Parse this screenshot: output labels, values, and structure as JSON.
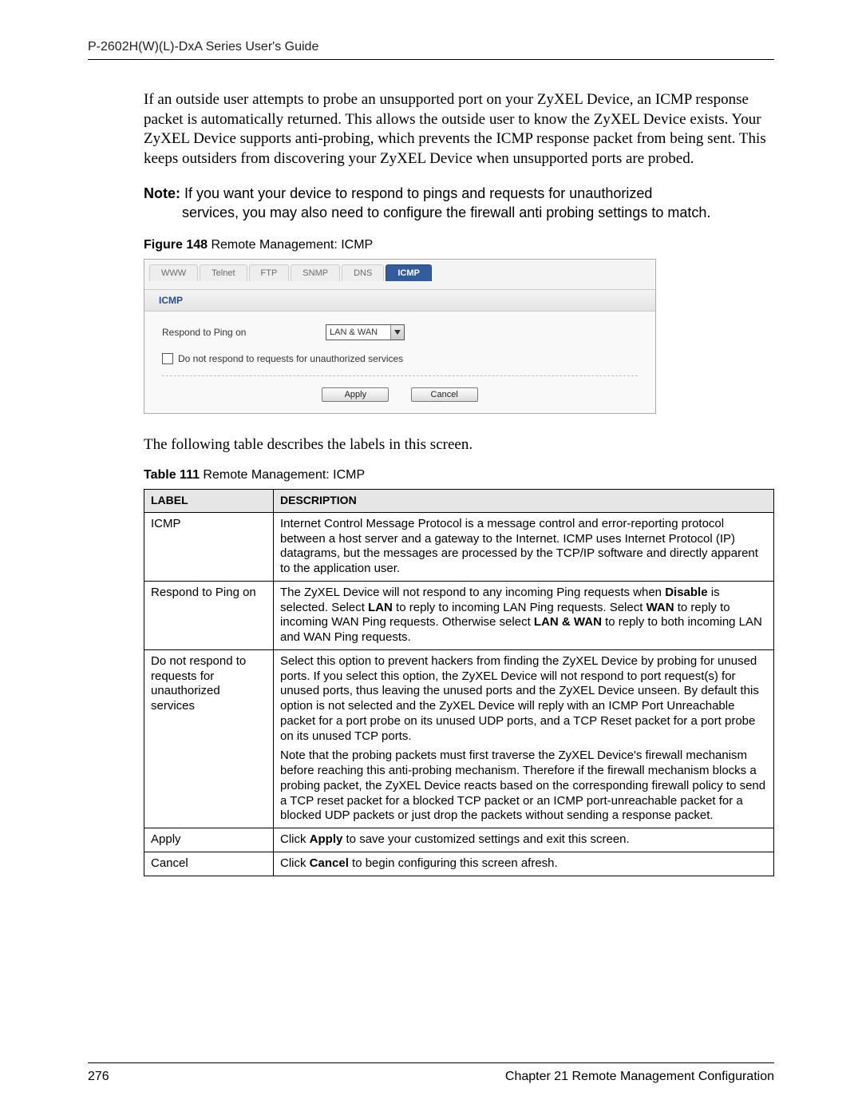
{
  "header": "P-2602H(W)(L)-DxA Series User's Guide",
  "intro": "If an outside user attempts to probe an unsupported port on your ZyXEL Device, an ICMP response packet is automatically returned. This allows the outside user to know the ZyXEL Device exists. Your ZyXEL Device supports anti-probing, which prevents the ICMP response packet from being sent. This keeps outsiders from discovering your ZyXEL Device when unsupported ports are probed.",
  "note_label": "Note:",
  "note_body": "If you want your device to respond to pings and requests for unauthorized services, you may also need to configure the firewall anti probing settings to match.",
  "figure": {
    "prefix": "Figure 148",
    "title": "   Remote Management: ICMP"
  },
  "ui": {
    "tabs": [
      "WWW",
      "Telnet",
      "FTP",
      "SNMP",
      "DNS",
      "ICMP"
    ],
    "active_tab": "ICMP",
    "section": "ICMP",
    "respond_label": "Respond to Ping on",
    "respond_value": "LAN & WAN",
    "checkbox_label": "Do not respond to requests for unauthorized services",
    "apply": "Apply",
    "cancel": "Cancel"
  },
  "after_fig": "The following table describes the labels in this screen.",
  "table_caption": {
    "prefix": "Table 111",
    "title": "   Remote Management: ICMP"
  },
  "table": {
    "h1": "Label",
    "h2": "Description",
    "rows": [
      {
        "label": "ICMP",
        "desc_html": "Internet Control Message Protocol is a message control and error-reporting protocol between a host server and a gateway to the Internet. ICMP uses Internet Protocol (IP) datagrams, but the messages are processed by the TCP/IP software and directly apparent to the application user."
      },
      {
        "label": "Respond to Ping on",
        "desc_html": "The ZyXEL Device will not respond to any incoming Ping requests when <b>Disable</b> is selected. Select <b>LAN</b> to reply to incoming LAN Ping requests. Select <b>WAN</b> to reply to incoming WAN Ping requests. Otherwise select <b>LAN & WAN</b> to reply to both incoming LAN and WAN Ping requests."
      },
      {
        "label": "Do not respond to requests for unauthorized services",
        "desc_html": "Select this option to prevent hackers from finding the ZyXEL Device by probing for unused ports. If you select this option, the ZyXEL Device will not respond to port request(s) for unused ports, thus leaving the unused ports and the ZyXEL Device unseen. By default this option is not selected and the ZyXEL Device will reply with an ICMP Port Unreachable packet for a port probe on its unused UDP ports, and a TCP Reset packet for a port probe on its unused TCP ports.<div style='height:6px'></div>Note that the probing packets must first traverse the ZyXEL Device's firewall mechanism before reaching this anti-probing mechanism. Therefore if the firewall mechanism blocks a probing packet, the ZyXEL Device reacts based on the corresponding firewall policy to send a TCP reset packet for a blocked TCP packet or an ICMP port-unreachable packet for a blocked UDP packets or just drop the packets without sending a response packet."
      },
      {
        "label": "Apply",
        "desc_html": "Click <b>Apply</b> to save your customized settings and exit this screen."
      },
      {
        "label": "Cancel",
        "desc_html": "Click <b>Cancel</b> to begin configuring this screen afresh."
      }
    ]
  },
  "footer": {
    "page": "276",
    "chapter": "Chapter 21 Remote Management Configuration"
  }
}
